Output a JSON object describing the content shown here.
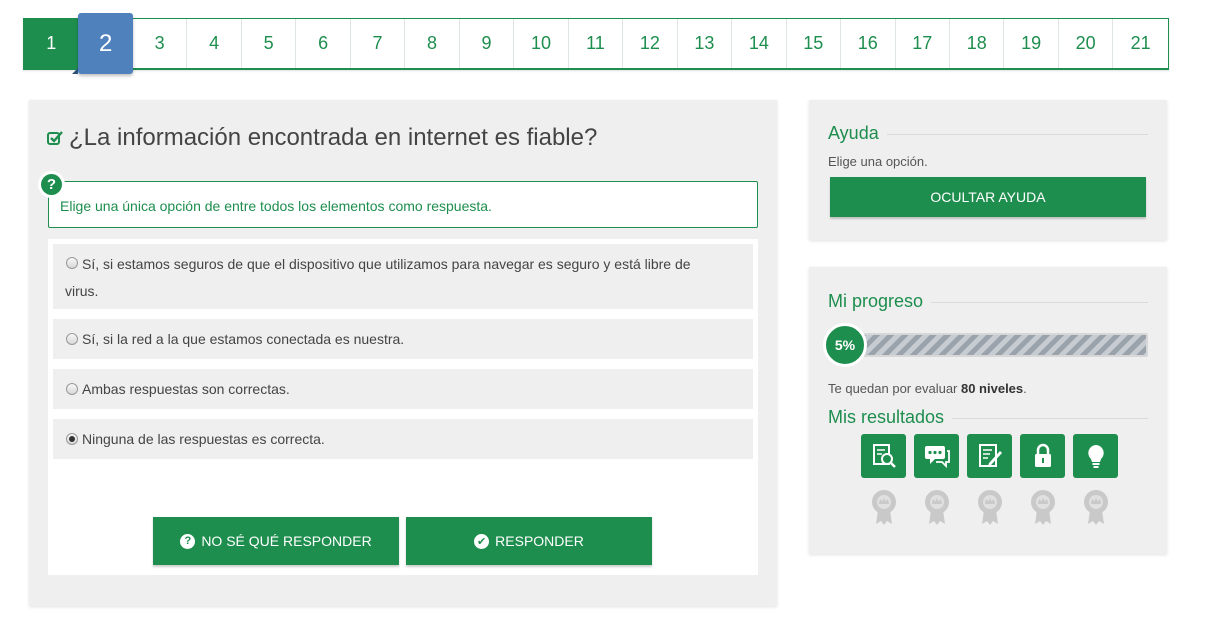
{
  "steps": [
    "1",
    "2",
    "3",
    "4",
    "5",
    "6",
    "7",
    "8",
    "9",
    "10",
    "11",
    "12",
    "13",
    "14",
    "15",
    "16",
    "17",
    "18",
    "19",
    "20",
    "21"
  ],
  "question": {
    "title": "¿La información encontrada en internet es fiable?",
    "instruction": "Elige una única opción de entre todos los elementos como respuesta.",
    "options": [
      "Sí, si estamos seguros de que el dispositivo que utilizamos para navegar es seguro y está libre de virus.",
      "Sí, si la red a la que estamos conectada es nuestra.",
      "Ambas respuestas son correctas.",
      "Ninguna de las respuestas es correcta."
    ],
    "selected_option": "Ninguna de las respuestas es correcta.",
    "dont_know_button": "NO SÉ QUÉ RESPONDER",
    "answer_button": "RESPONDER"
  },
  "help": {
    "title": "Ayuda",
    "text": "Elige una opción.",
    "hide_button": "OCULTAR AYUDA"
  },
  "progress": {
    "title": "Mi progreso",
    "percent_label": "5%",
    "percent_value": 5,
    "remaining_prefix": "Te quedan por evaluar ",
    "remaining_count": "80 niveles",
    "remaining_suffix": ".",
    "results_title": "Mis resultados",
    "result_icons": [
      "document-search-icon",
      "chat-icon",
      "document-edit-icon",
      "lock-icon",
      "lightbulb-icon"
    ]
  },
  "colors": {
    "primary_green": "#1e8e4e",
    "current_step_blue": "#4f81bd",
    "panel_bg": "#efefef"
  }
}
